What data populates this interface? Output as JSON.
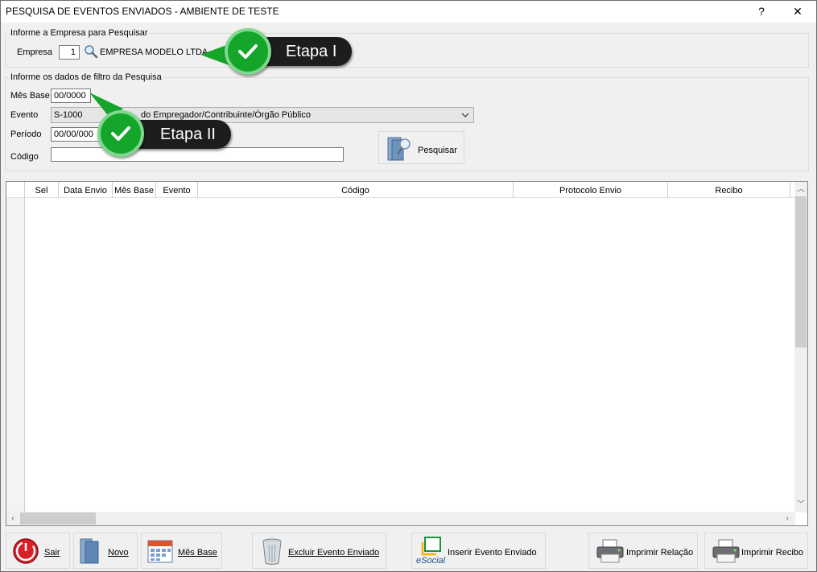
{
  "window": {
    "title": "PESQUISA DE EVENTOS ENVIADOS - AMBIENTE DE TESTE",
    "help_label": "?",
    "close_label": "✕"
  },
  "company_group": {
    "legend": "Informe a Empresa para Pesquisar",
    "label": "Empresa",
    "code": "1",
    "name": "EMPRESA MODELO LTDA"
  },
  "filter_group": {
    "legend": "Informe os dados de filtro da Pesquisa",
    "mes_base_label": "Mês Base",
    "mes_base_value": "00/0000",
    "evento_label": "Evento",
    "evento_code": "S-1000",
    "evento_text": "do Empregador/Contribuinte/Órgão Público",
    "periodo_label": "Período",
    "periodo_start": "00/00/000",
    "codigo_label": "Código",
    "codigo_value": "",
    "search_button": "Pesquisar"
  },
  "grid": {
    "columns": [
      "Sel",
      "Data Envio",
      "Mês Base",
      "Evento",
      "Código",
      "Protocolo Envio",
      "Recibo"
    ],
    "rows": []
  },
  "callouts": {
    "step1": "Etapa I",
    "step2": "Etapa II"
  },
  "footer": {
    "sair": "Sair",
    "novo": "Novo",
    "mes_base": "Mês Base",
    "excluir": "Excluir Evento Enviado",
    "inserir": "Inserir Evento Enviado",
    "esocial_logo": "eSocial",
    "imprimir_relacao": "Imprimir Relação",
    "imprimir_recibo": "Imprimir Recibo"
  },
  "colors": {
    "callout_bg": "#1d1d1d",
    "check_green": "#15a52a",
    "sair_red": "#d6202a"
  }
}
